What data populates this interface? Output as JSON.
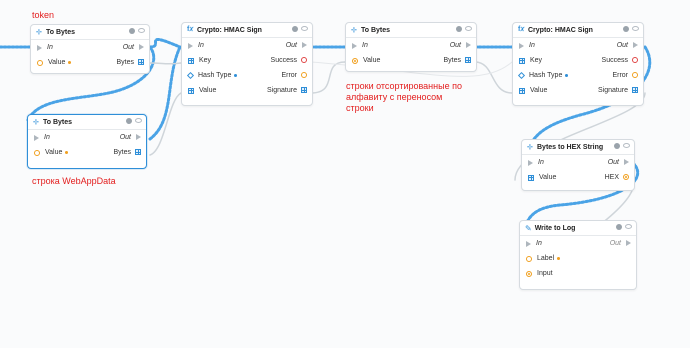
{
  "annotations": {
    "token": "token",
    "webappdata": "строка WebAppData",
    "sorted": "строки отсортированные по алфавиту с переносом строки"
  },
  "nodes": {
    "to_bytes_1": {
      "title": "To Bytes",
      "in": "In",
      "out": "Out",
      "value": "Value",
      "bytes": "Bytes"
    },
    "to_bytes_2": {
      "title": "To Bytes",
      "in": "In",
      "out": "Out",
      "value": "Value",
      "bytes": "Bytes"
    },
    "hmac_1": {
      "title": "Crypto: HMAC Sign",
      "in": "In",
      "out": "Out",
      "key": "Key",
      "success": "Success",
      "hash_type": "Hash Type",
      "error": "Error",
      "value": "Value",
      "signature": "Signature"
    },
    "to_bytes_3": {
      "title": "To Bytes",
      "in": "In",
      "out": "Out",
      "value": "Value",
      "bytes": "Bytes"
    },
    "hmac_2": {
      "title": "Crypto: HMAC Sign",
      "in": "In",
      "out": "Out",
      "key": "Key",
      "success": "Success",
      "hash_type": "Hash Type",
      "error": "Error",
      "value": "Value",
      "signature": "Signature"
    },
    "bytes_hex": {
      "title": "Bytes to HEX String",
      "in": "In",
      "out": "Out",
      "value": "Value",
      "hex": "HEX"
    },
    "write_log": {
      "title": "Write to Log",
      "in": "In",
      "out": "Out",
      "label": "Label",
      "input": "Input"
    }
  },
  "colors": {
    "accent": "#2f8fd8",
    "annotation": "#e31e1e",
    "port_orange": "#f0a020",
    "port_red": "#e04545"
  }
}
